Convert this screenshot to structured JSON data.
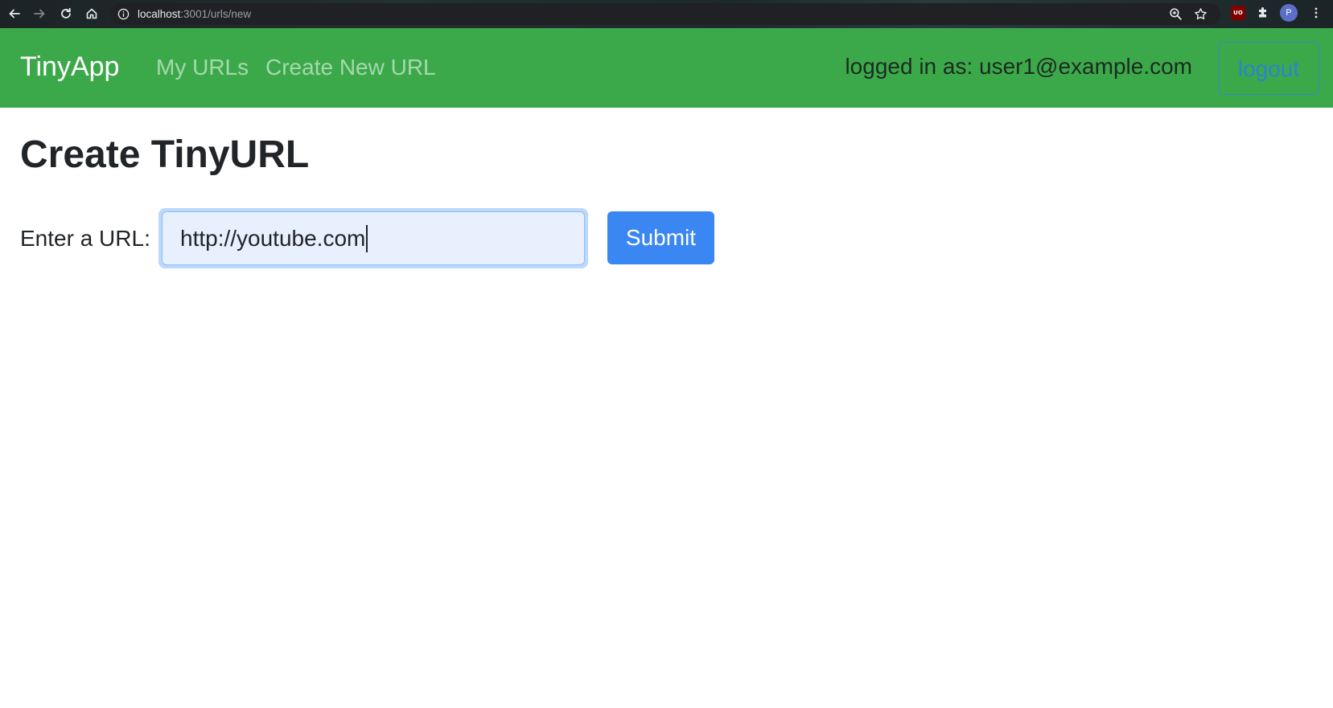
{
  "browser": {
    "url_host": "localhost",
    "url_path": ":3001/urls/new",
    "profile_initial": "P",
    "ublock_label": "UO",
    "icons": {
      "back": "arrow-left-icon",
      "forward": "arrow-right-icon",
      "reload": "reload-icon",
      "home": "home-icon",
      "info": "info-icon",
      "zoom": "zoom-icon",
      "bookmark": "star-icon",
      "extensions": "puzzle-icon",
      "menu": "kebab-menu-icon"
    }
  },
  "navbar": {
    "brand": "TinyApp",
    "links": [
      {
        "label": "My URLs"
      },
      {
        "label": "Create New URL"
      }
    ],
    "logged_in_text": "logged in as: user1@example.com",
    "logout_label": "logout",
    "colors": {
      "background": "#3ba94a",
      "logout_text": "#2b84d0"
    }
  },
  "main": {
    "title": "Create TinyURL",
    "form": {
      "label": "Enter a URL:",
      "input_value": "http://youtube.com",
      "submit_label": "Submit",
      "submit_color": "#3a86f2"
    }
  }
}
